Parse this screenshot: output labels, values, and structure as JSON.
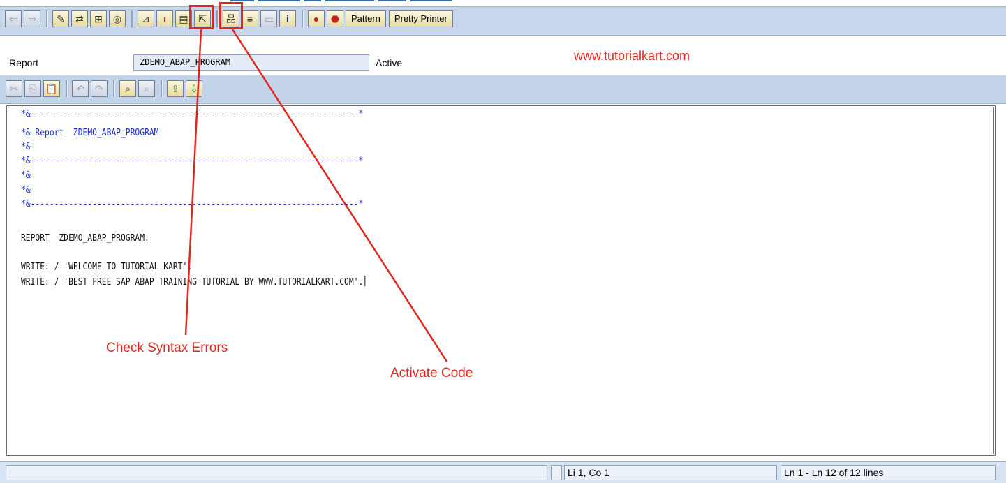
{
  "toolbar": {
    "pattern_label": "Pattern",
    "pretty_printer_label": "Pretty Printer",
    "icons": [
      "back-icon",
      "forward-icon",
      "other-object-icon",
      "display-change-icon",
      "where-used-icon",
      "object-list-icon",
      "check-syntax-icon",
      "activate-icon",
      "test-icon",
      "navigate-icon",
      "object-list-display-icon",
      "enhancement-icon",
      "split-screen-icon",
      "help-info-icon",
      "set-breakpoint-icon",
      "stop-breakpoint-icon"
    ]
  },
  "header": {
    "report_label": "Report",
    "program_name": "ZDEMO_ABAP_PROGRAM",
    "status": "Active",
    "website": "www.tutorialkart.com"
  },
  "editor": {
    "lines": [
      {
        "text": "*&---------------------------------------------------------------------*",
        "type": "comment"
      },
      {
        "text": "*& Report  ZDEMO_ABAP_PROGRAM",
        "type": "comment"
      },
      {
        "text": "*&",
        "type": "comment"
      },
      {
        "text": "*&---------------------------------------------------------------------*",
        "type": "comment"
      },
      {
        "text": "*&",
        "type": "comment"
      },
      {
        "text": "*&",
        "type": "comment"
      },
      {
        "text": "*&---------------------------------------------------------------------*",
        "type": "comment"
      },
      {
        "text": "",
        "type": "blank"
      },
      {
        "text": "REPORT  ZDEMO_ABAP_PROGRAM.",
        "type": "code"
      },
      {
        "text": "",
        "type": "blank"
      },
      {
        "text": "WRITE: / 'WELCOME TO TUTORIAL KART'.",
        "type": "code"
      },
      {
        "text": "WRITE: / 'BEST FREE SAP ABAP TRAINING TUTORIAL BY WWW.TUTORIALKART.COM'.",
        "type": "code"
      }
    ]
  },
  "annotations": {
    "check_syntax": "Check Syntax Errors",
    "activate_code": "Activate Code",
    "color": "#e3261d"
  },
  "statusbar": {
    "cursor": "Li 1, Co 1",
    "lines_info": "Ln 1 - Ln 12 of 12 lines"
  },
  "colors": {
    "appbar": "#c7d6ea",
    "comment": "#1b2bd8",
    "highlight": "#e8251a"
  }
}
